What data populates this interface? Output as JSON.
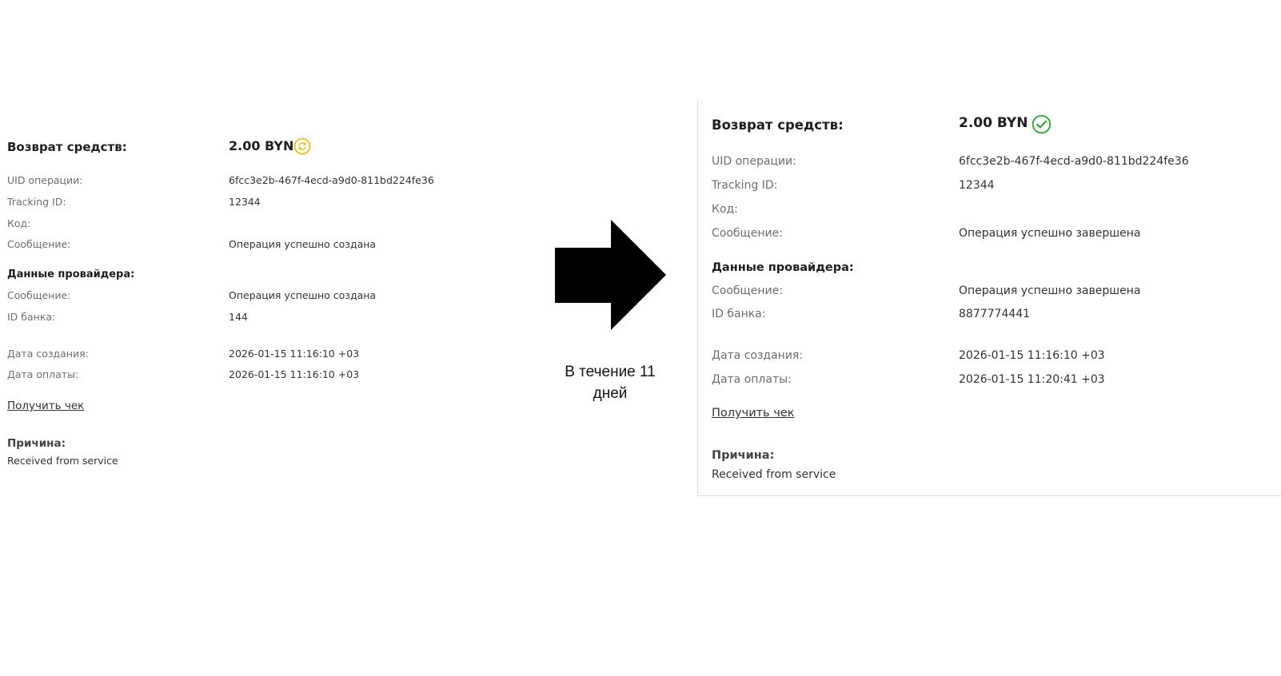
{
  "before": {
    "refund_heading": "Возврат средств:",
    "amount": "2.00 BYN",
    "status_icon": "pending-refresh-icon",
    "status_color": "#e3bd1c",
    "uid_label": "UID операции:",
    "uid_value": "6fcc3e2b-467f-4ecd-a9d0-811bd224fe36",
    "tracking_label": "Tracking ID:",
    "tracking_value": "12344",
    "code_label": "Код:",
    "message_label": "Сообщение:",
    "message_value": "Операция успешно создана",
    "provider_heading": "Данные провайдера:",
    "provider_message_label": "Сообщение:",
    "provider_message_value": "Операция успешно создана",
    "bank_id_label": "ID банка:",
    "bank_id_value": "144",
    "created_label": "Дата создания:",
    "created_value": "2026-01-15 11:16:10 +03",
    "paid_label": "Дата оплаты:",
    "paid_value": "2026-01-15 11:16:10 +03",
    "receipt_link": "Получить чек",
    "reason_heading": "Причина:",
    "reason_value": "Received from service"
  },
  "transition": {
    "arrow_icon": "right-arrow-icon",
    "caption": "В течение 11 дней"
  },
  "after": {
    "refund_heading": "Возврат средств:",
    "amount": "2.00 BYN",
    "status_icon": "success-check-icon",
    "status_color": "#3aa845",
    "uid_label": "UID операции:",
    "uid_value": "6fcc3e2b-467f-4ecd-a9d0-811bd224fe36",
    "tracking_label": "Tracking ID:",
    "tracking_value": "12344",
    "code_label": "Код:",
    "message_label": "Сообщение:",
    "message_value": "Операция успешно завершена",
    "provider_heading": "Данные провайдера:",
    "provider_message_label": "Сообщение:",
    "provider_message_value": "Операция успешно завершена",
    "bank_id_label": "ID банка:",
    "bank_id_value": "8877774441",
    "created_label": "Дата создания:",
    "created_value": "2026-01-15 11:16:10 +03",
    "paid_label": "Дата оплаты:",
    "paid_value": "2026-01-15 11:20:41 +03",
    "receipt_link": "Получить чек",
    "reason_heading": "Причина:",
    "reason_value": "Received from service"
  }
}
